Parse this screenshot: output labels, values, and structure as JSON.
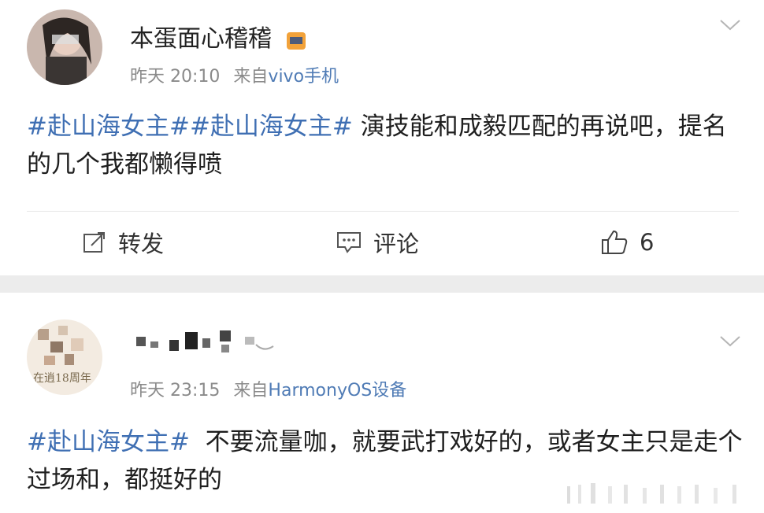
{
  "post1": {
    "username": "本蛋面心稽稽",
    "time": "昨天 20:10",
    "source_prefix": "来自",
    "source": "vivo手机",
    "content_tags": [
      "#赴山海女主#",
      "#赴山海女主#"
    ],
    "content_text": " 演技能和成毅匹配的再说吧，提名的几个我都懒得喷",
    "actions": {
      "repost": "转发",
      "comment": "评论",
      "like_count": "6"
    }
  },
  "post2": {
    "time": "昨天 23:15",
    "source_prefix": "来自",
    "source": "HarmonyOS设备",
    "avatar_caption": "在逍18周年",
    "content_tag": "#赴山海女主#",
    "content_text": "  不要流量咖，就要武打戏好的，或者女主只是走个过场和，都挺好的"
  },
  "colors": {
    "link": "#3f6fb3",
    "meta": "#8a8a8a",
    "separator": "#ececec"
  }
}
